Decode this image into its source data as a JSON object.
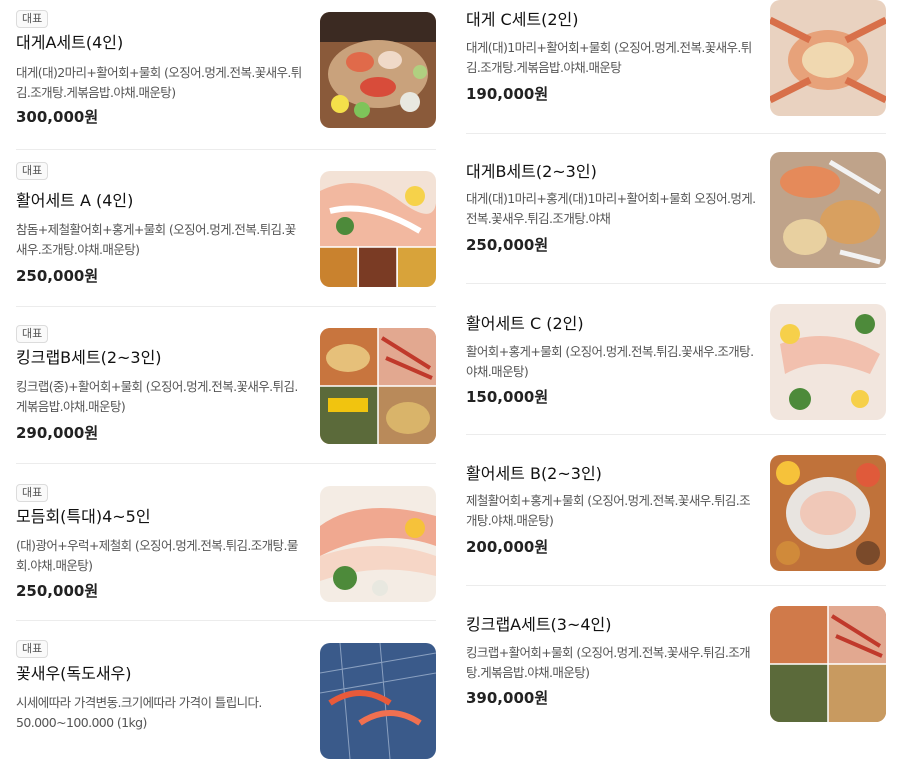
{
  "menu_left": [
    {
      "badge": "대표",
      "name": "대게A세트(4인)",
      "desc": "대게(대)2마리+활어회+물회 (오징어.멍게.전복.꽃새우.튀김.조개탕.게볶음밥.야채.매운탕)",
      "price": "300,000원",
      "image": "crab-set-table-photo"
    },
    {
      "badge": "대표",
      "name": "활어세트 A (4인)",
      "desc": "참돔+제철활어회+홍게+물회 (오징어.멍게.전복.튀김.꽃새우.조개탕.야채.매운탕)",
      "price": "250,000원",
      "image": "sashimi-collage-photo"
    },
    {
      "badge": "대표",
      "name": "킹크랩B세트(2~3인)",
      "desc": "킹크랩(중)+활어회+물회 (오징어.멍게.전복.꽃새우.튀김.게볶음밥.야채.매운탕)",
      "price": "290,000원",
      "image": "king-crab-collage-photo"
    },
    {
      "badge": "대표",
      "name": "모듬회(특대)4~5인",
      "desc": "(대)광어+우럭+제철회 (오징어.멍게.전복.튀김.조개탕.물회.야채.매운탕)",
      "price": "250,000원",
      "image": "assorted-sashimi-photo"
    },
    {
      "badge": "대표",
      "name": "꽃새우(독도새우)",
      "desc": "시세에따라 가격변동.크기에따라 가격이 틀립니다. 50.000~100.000 (1kg)",
      "price": "",
      "image": "shrimp-tank-photo"
    }
  ],
  "menu_right": [
    {
      "name": "대게 C세트(2인)",
      "desc": "대게(대)1마리+활어회+물회 (오징어.멍게.전복.꽃새우.튀김.조개탕.게볶음밥.야채.매운탕",
      "price": "190,000원",
      "image": "steamed-crab-photo"
    },
    {
      "name": "대게B세트(2~3인)",
      "desc": "대게(대)1마리+홍게(대)1마리+활어회+물회 오징어.멍게.전복.꽃새우.튀김.조개탕.야채",
      "price": "250,000원",
      "image": "crab-platter-photo"
    },
    {
      "name": "활어세트 C (2인)",
      "desc": "활어회+홍게+물회 (오징어.멍게.전복.튀김.꽃새우.조개탕.야채.매운탕)",
      "price": "150,000원",
      "image": "sashimi-plate-photo"
    },
    {
      "name": "활어세트 B(2~3인)",
      "desc": "제철활어회+홍게+물회 (오징어.멍게.전복.꽃새우.튀김.조개탕.야채.매운탕)",
      "price": "200,000원",
      "image": "sashimi-spread-photo"
    },
    {
      "name": "킹크랩A세트(3~4인)",
      "desc": "킹크랩+활어회+물회 (오징어.멍게.전복.꽃새우.튀김.조개탕.게볶음밥.야채.매운탕)",
      "price": "390,000원",
      "image": "king-crab-set-photo"
    }
  ]
}
